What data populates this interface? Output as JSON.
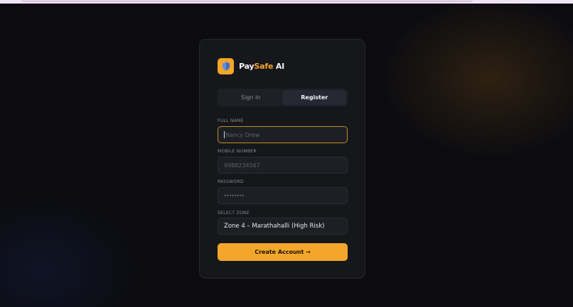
{
  "brand": {
    "name_prefix": "Pay",
    "name_accent": "Safe",
    "name_suffix": " AI",
    "logo_icon": "shield-icon"
  },
  "tabs": [
    {
      "label": "Sign In",
      "active": false
    },
    {
      "label": "Register",
      "active": true
    }
  ],
  "form": {
    "full_name": {
      "label": "FULL NAME",
      "placeholder": "Nancy Drew",
      "value": ""
    },
    "mobile": {
      "label": "MOBILE NUMBER",
      "placeholder": "9988234567",
      "value": ""
    },
    "password": {
      "label": "PASSWORD",
      "value": "••••••••"
    },
    "zone": {
      "label": "SELECT ZONE",
      "value": "Zone 4 – Marathahalli (High Risk)"
    }
  },
  "submit_label": "Create Account →",
  "colors": {
    "accent": "#f4a62a",
    "card": "#16171b",
    "background": "#0c0c10"
  }
}
